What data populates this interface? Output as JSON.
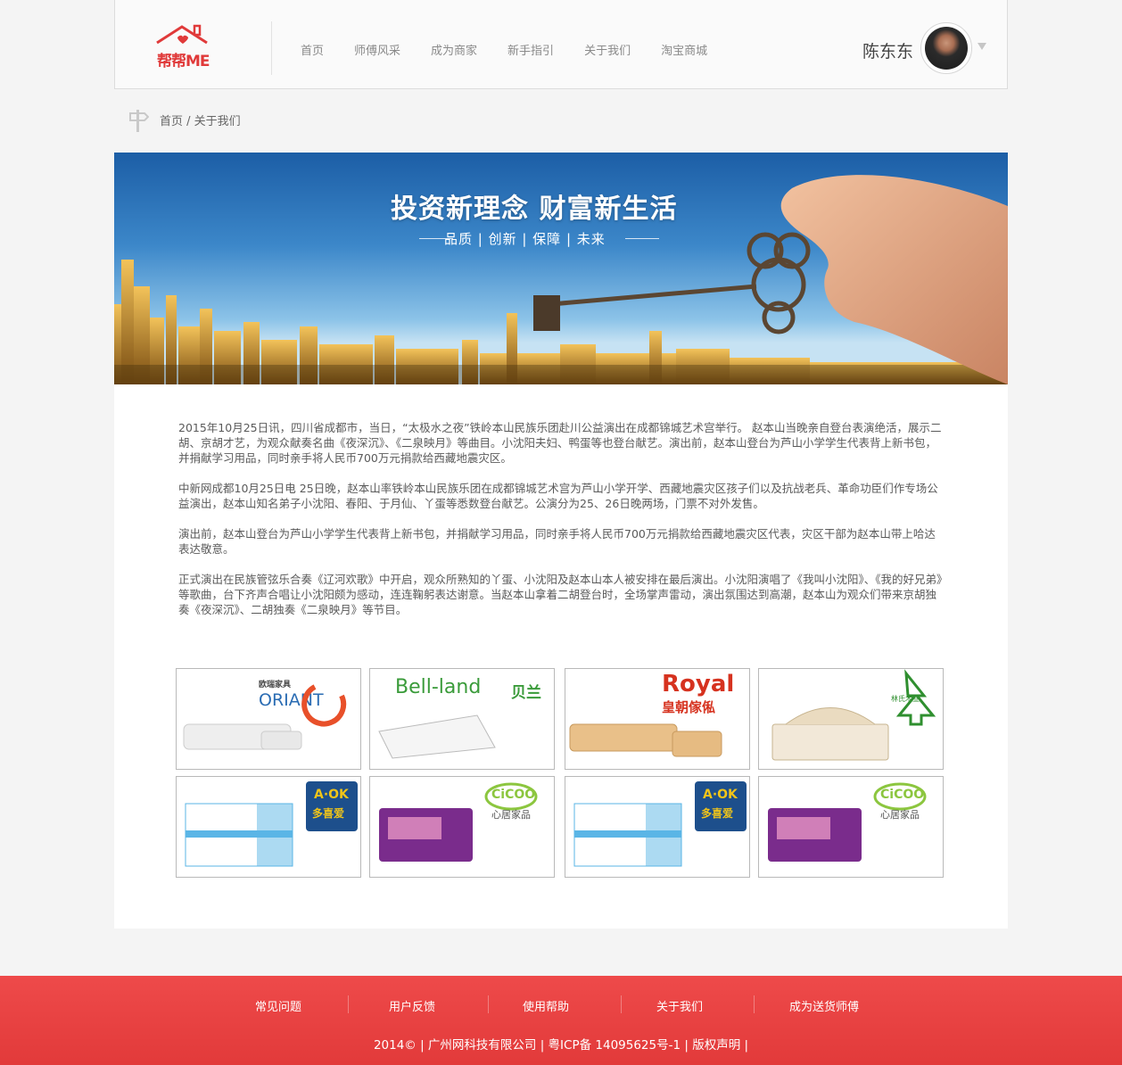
{
  "header": {
    "logo_text": "帮帮ME",
    "nav": [
      "首页",
      "师傅风采",
      "成为商家",
      "新手指引",
      "关于我们",
      "淘宝商城"
    ],
    "username": "陈东东"
  },
  "breadcrumb": "首页 / 关于我们",
  "banner": {
    "title": "投资新理念  财富新生活",
    "subtitle": "品质 | 创新 | 保障 | 未来"
  },
  "article": {
    "paragraphs": [
      "2015年10月25日讯，四川省成都市，当日，“太极水之夜”铁岭本山民族乐团赴川公益演出在成都锦城艺术宫举行。 赵本山当晚亲自登台表演绝活，展示二胡、京胡才艺，为观众献奏名曲《夜深沉》、《二泉映月》等曲目。小沈阳夫妇、鸭蛋等也登台献艺。演出前，赵本山登台为芦山小学学生代表背上新书包，并捐献学习用品，同时亲手将人民币700万元捐款给西藏地震灾区。",
      "中新网成都10月25日电 25日晚，赵本山率铁岭本山民族乐团在成都锦城艺术宫为芦山小学开学、西藏地震灾区孩子们以及抗战老兵、革命功臣们作专场公益演出，赵本山知名弟子小沈阳、春阳、于月仙、丫蛋等悉数登台献艺。公演分为25、26日晚两场，门票不对外发售。",
      "演出前，赵本山登台为芦山小学学生代表背上新书包，并捐献学习用品，同时亲手将人民币700万元捐款给西藏地震灾区代表，灾区干部为赵本山带上哈达表达敬意。",
      "正式演出在民族管弦乐合奏《辽河欢歌》中开启，观众所熟知的丫蛋、小沈阳及赵本山本人被安排在最后演出。小沈阳演唱了《我叫小沈阳》、《我的好兄弟》等歌曲，台下齐声合唱让小沈阳颇为感动，连连鞠躬表达谢意。当赵本山拿着二胡登台时，全场掌声雷动，演出氛围达到高潮，赵本山为观众们带来京胡独奏《夜深沉》、二胡独奏《二泉映月》等节目。"
    ]
  },
  "brands": [
    {
      "logo": "ORIANT",
      "sub": "欧瑞家具",
      "color": "#e8502a"
    },
    {
      "logo": "Bell-land",
      "sub": "贝兰",
      "color": "#3a9b3a"
    },
    {
      "logo": "Royal",
      "sub": "皇朝傢俬",
      "color": "#d6321f"
    },
    {
      "logo": "林氏木业",
      "sub": "",
      "color": "#2f8f2f"
    },
    {
      "logo": "A·OK",
      "sub": "多喜爱",
      "color": "#f0c419"
    },
    {
      "logo": "CiCOO",
      "sub": "心居家品",
      "color": "#8cc63f"
    },
    {
      "logo": "A·OK",
      "sub": "多喜爱",
      "color": "#f0c419"
    },
    {
      "logo": "CiCOO",
      "sub": "心居家品",
      "color": "#8cc63f"
    }
  ],
  "footer": {
    "links": [
      "常见问题",
      "用户反馈",
      "使用帮助",
      "关于我们",
      "成为送货师傅"
    ],
    "copyright": "2014©  |  广州网科技有限公司  |  粤ICP备 14095625号-1  |  版权声明  |"
  }
}
